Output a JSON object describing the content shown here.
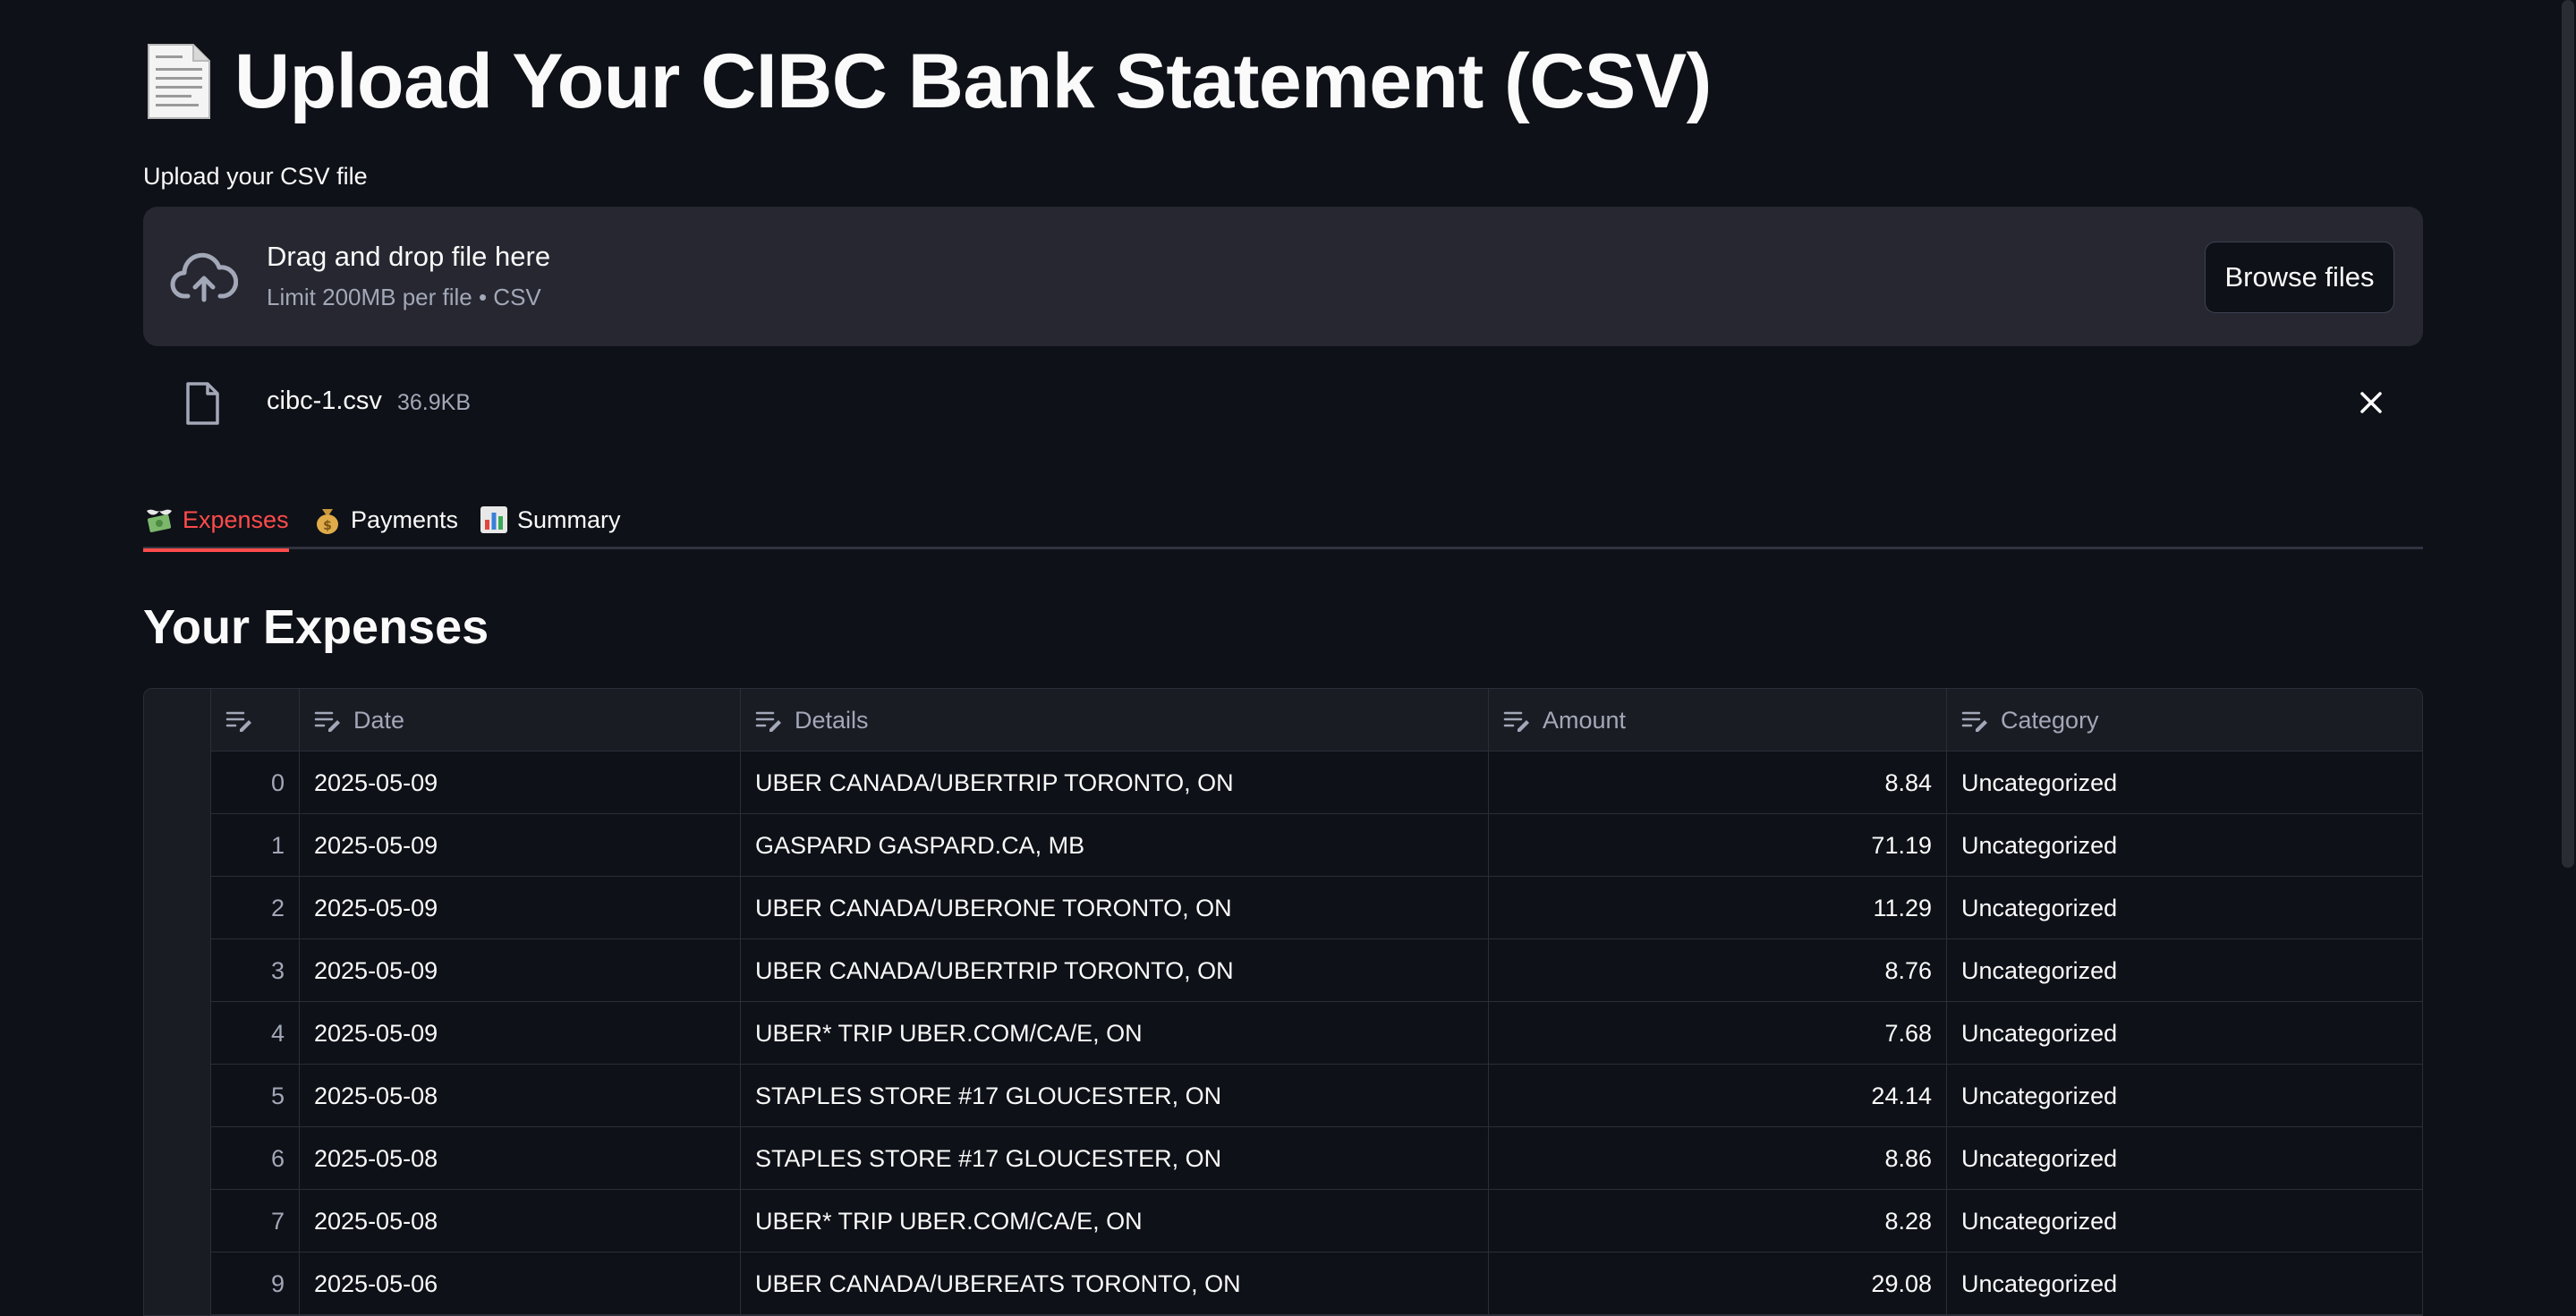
{
  "title": "Upload Your CIBC Bank Statement (CSV)",
  "uploader": {
    "label": "Upload your CSV file",
    "drop_title": "Drag and drop file here",
    "drop_limit": "Limit 200MB per file • CSV",
    "browse_label": "Browse files"
  },
  "file": {
    "name": "cibc-1.csv",
    "size": "36.9KB"
  },
  "tabs": [
    {
      "label": "Expenses",
      "icon": "money-with-wings-icon",
      "active": true
    },
    {
      "label": "Payments",
      "icon": "money-bag-icon",
      "active": false
    },
    {
      "label": "Summary",
      "icon": "bar-chart-icon",
      "active": false
    }
  ],
  "section_heading": "Your Expenses",
  "table": {
    "columns": [
      "",
      "Date",
      "Details",
      "Amount",
      "Category"
    ],
    "rows": [
      {
        "idx": "0",
        "date": "2025-05-09",
        "details": "UBER CANADA/UBERTRIP TORONTO, ON",
        "amount": "8.84",
        "category": "Uncategorized"
      },
      {
        "idx": "1",
        "date": "2025-05-09",
        "details": "GASPARD GASPARD.CA, MB",
        "amount": "71.19",
        "category": "Uncategorized"
      },
      {
        "idx": "2",
        "date": "2025-05-09",
        "details": "UBER CANADA/UBERONE TORONTO, ON",
        "amount": "11.29",
        "category": "Uncategorized"
      },
      {
        "idx": "3",
        "date": "2025-05-09",
        "details": "UBER CANADA/UBERTRIP TORONTO, ON",
        "amount": "8.76",
        "category": "Uncategorized"
      },
      {
        "idx": "4",
        "date": "2025-05-09",
        "details": "UBER* TRIP UBER.COM/CA/E, ON",
        "amount": "7.68",
        "category": "Uncategorized"
      },
      {
        "idx": "5",
        "date": "2025-05-08",
        "details": "STAPLES STORE #17 GLOUCESTER, ON",
        "amount": "24.14",
        "category": "Uncategorized"
      },
      {
        "idx": "6",
        "date": "2025-05-08",
        "details": "STAPLES STORE #17 GLOUCESTER, ON",
        "amount": "8.86",
        "category": "Uncategorized"
      },
      {
        "idx": "7",
        "date": "2025-05-08",
        "details": "UBER* TRIP UBER.COM/CA/E, ON",
        "amount": "8.28",
        "category": "Uncategorized"
      },
      {
        "idx": "9",
        "date": "2025-05-06",
        "details": "UBER CANADA/UBEREATS TORONTO, ON",
        "amount": "29.08",
        "category": "Uncategorized"
      }
    ]
  },
  "colors": {
    "background": "#0e1117",
    "accent": "#ff4b4b",
    "dropzone": "#262730"
  }
}
